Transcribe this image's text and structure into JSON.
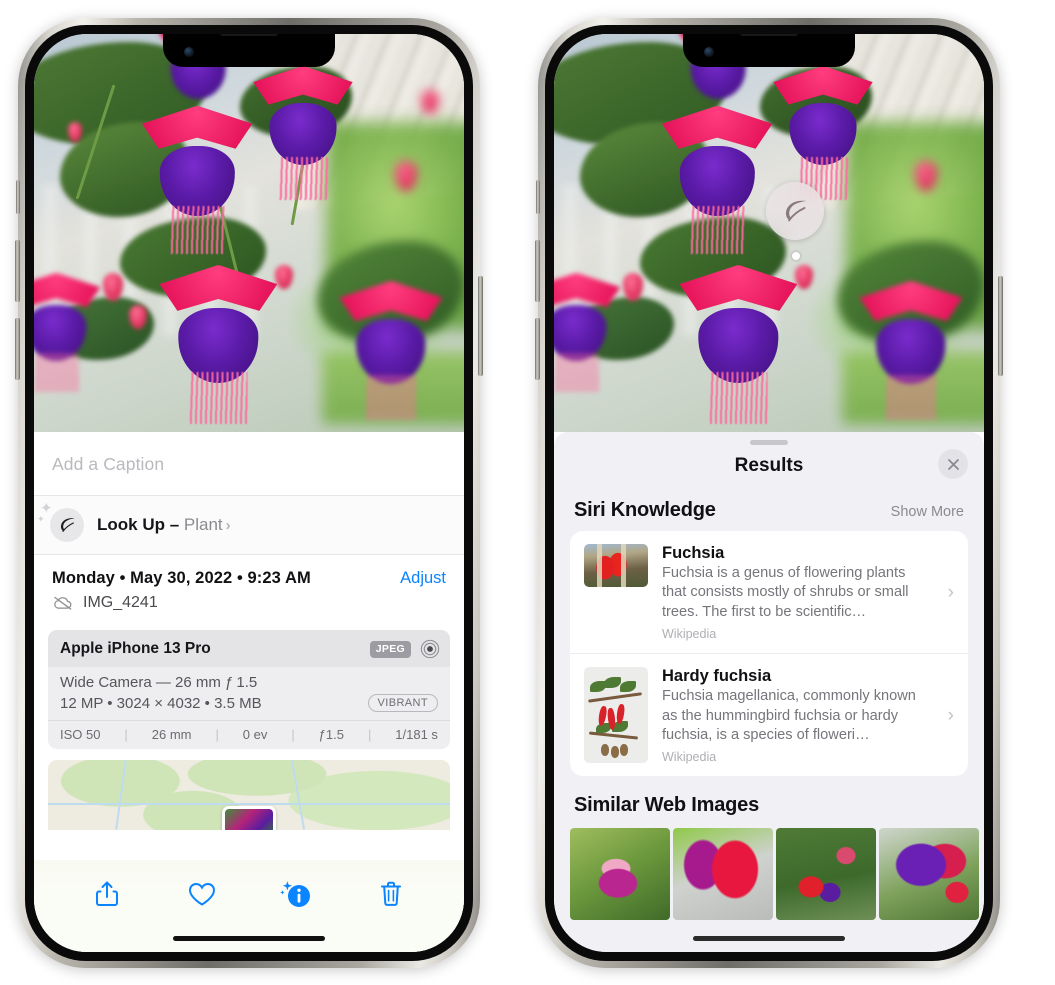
{
  "left_phone": {
    "photo": {
      "alt": "Fuchsia flowers hanging basket on a porch"
    },
    "caption": {
      "placeholder": "Add a Caption",
      "value": ""
    },
    "lookup_row": {
      "icon": "leaf-icon",
      "label": "Look Up",
      "dash": " – ",
      "subject": "Plant",
      "chevron": "›"
    },
    "meta": {
      "date": "Monday • May 30, 2022 • 9:23 AM",
      "adjust_label": "Adjust",
      "filename": "IMG_4241",
      "cloud_icon": "cloud-slash-icon"
    },
    "exif": {
      "device": "Apple iPhone 13 Pro",
      "format_badge": "JPEG",
      "raw_icon": "raw-ring-icon",
      "lens": "Wide Camera — 26 mm ƒ 1.5",
      "size_line": "12 MP • 3024 × 4032 • 3.5 MB",
      "style_badge": "VIBRANT",
      "stats": [
        "ISO 50",
        "26 mm",
        "0 ev",
        "ƒ1.5",
        "1/181 s"
      ]
    },
    "map": {
      "pin": "photo-pin"
    },
    "toolbar": {
      "share": "share-icon",
      "favorite": "heart-icon",
      "info": "info-sparkle-icon",
      "delete": "trash-icon"
    }
  },
  "right_phone": {
    "photo": {
      "alt": "Fuchsia flowers hanging basket on a porch"
    },
    "badge": {
      "icon": "leaf-icon"
    },
    "sheet": {
      "title": "Results",
      "close_label": "close-icon",
      "sections": [
        {
          "title": "Siri Knowledge",
          "action": "Show More",
          "items": [
            {
              "title": "Fuchsia",
              "description": "Fuchsia is a genus of flowering plants that consists mostly of shrubs or small trees. The first to be scientific…",
              "source": "Wikipedia",
              "chevron": "›"
            },
            {
              "title": "Hardy fuchsia",
              "description": "Fuchsia magellanica, commonly known as the hummingbird fuchsia or hardy fuchsia, is a species of floweri…",
              "source": "Wikipedia",
              "chevron": "›"
            }
          ]
        },
        {
          "title": "Similar Web Images",
          "images": [
            "web-image-1",
            "web-image-2",
            "web-image-3",
            "web-image-4"
          ]
        }
      ]
    }
  },
  "colors": {
    "accent_blue": "#0a84ff",
    "sheet_bg": "#f1f1f5",
    "card_bg": "#ffffff",
    "secondary_text": "#8a8a90"
  }
}
